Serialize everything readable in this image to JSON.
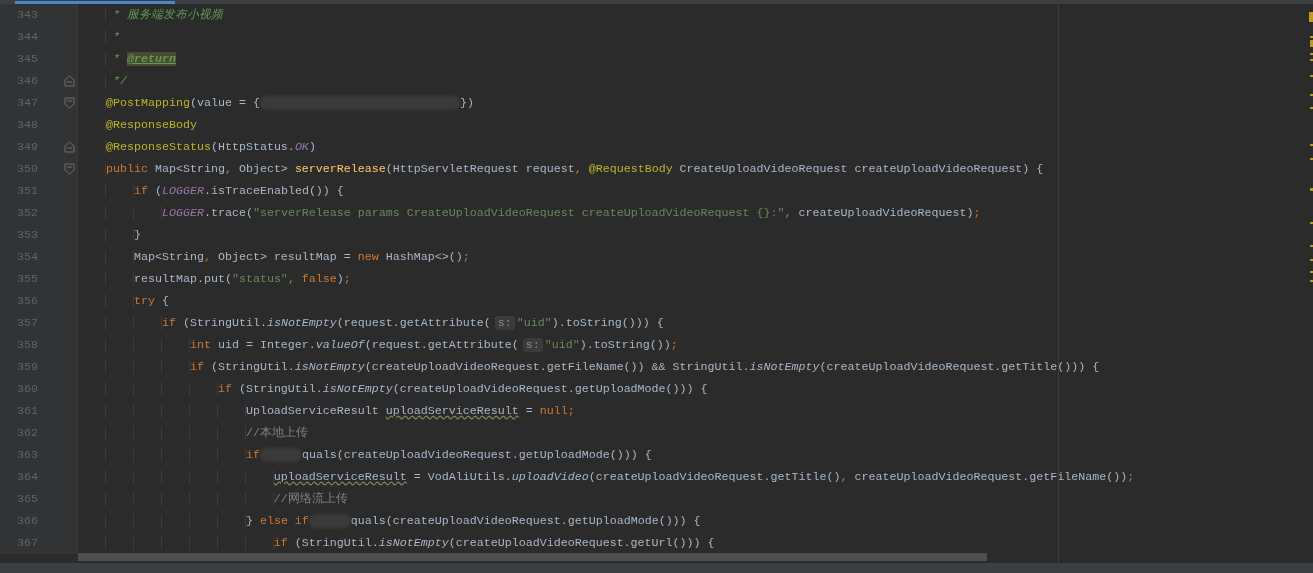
{
  "editor": {
    "lines": [
      {
        "number": "343",
        "fold_start": false,
        "fold_end": false,
        "tokens": [
          {
            "kind": "doc",
            "text": "     * 服务端发布小视频"
          }
        ]
      },
      {
        "number": "344",
        "fold_start": false,
        "fold_end": false,
        "tokens": [
          {
            "kind": "doc",
            "text": "     *"
          }
        ]
      },
      {
        "number": "345",
        "fold_start": false,
        "fold_end": false,
        "tokens": [
          {
            "kind": "doc",
            "text": "     * "
          },
          {
            "kind": "doctag",
            "text": "@return"
          }
        ]
      },
      {
        "number": "346",
        "fold_start": false,
        "fold_end": true,
        "tokens": [
          {
            "kind": "doc",
            "text": "     */"
          }
        ]
      },
      {
        "number": "347",
        "fold_start": true,
        "fold_end": false,
        "tokens": [
          {
            "kind": "annotation",
            "text": "    @PostMapping"
          },
          {
            "kind": "plain",
            "text": "(value = {"
          },
          {
            "kind": "redacted",
            "long": true
          },
          {
            "kind": "plain",
            "text": "})"
          }
        ]
      },
      {
        "number": "348",
        "fold_start": false,
        "fold_end": false,
        "tokens": [
          {
            "kind": "annotation",
            "text": "    @ResponseBody"
          }
        ]
      },
      {
        "number": "349",
        "fold_start": false,
        "fold_end": true,
        "tokens": [
          {
            "kind": "annotation",
            "text": "    @ResponseStatus"
          },
          {
            "kind": "plain",
            "text": "(HttpStatus."
          },
          {
            "kind": "field",
            "text": "OK"
          },
          {
            "kind": "plain",
            "text": ")"
          }
        ]
      },
      {
        "number": "350",
        "fold_start": true,
        "fold_end": false,
        "tokens": [
          {
            "kind": "keyword",
            "text": "    public "
          },
          {
            "kind": "plain",
            "text": "Map<String"
          },
          {
            "kind": "punct",
            "text": ","
          },
          {
            "kind": "plain",
            "text": " Object> "
          },
          {
            "kind": "declaration",
            "text": "serverRelease"
          },
          {
            "kind": "plain",
            "text": "(HttpServletRequest request"
          },
          {
            "kind": "punct",
            "text": ","
          },
          {
            "kind": "annotation",
            "text": " @RequestBody"
          },
          {
            "kind": "plain",
            "text": " CreateUploadVideoRequest createUploadVideoRequest) {"
          }
        ]
      },
      {
        "number": "351",
        "fold_start": false,
        "fold_end": false,
        "tokens": [
          {
            "kind": "keyword",
            "text": "        if"
          },
          {
            "kind": "plain",
            "text": " ("
          },
          {
            "kind": "field",
            "text": "LOGGER"
          },
          {
            "kind": "plain",
            "text": ".isTraceEnabled()) {"
          }
        ]
      },
      {
        "number": "352",
        "fold_start": false,
        "fold_end": false,
        "tokens": [
          {
            "kind": "field",
            "text": "            LOGGER"
          },
          {
            "kind": "plain",
            "text": ".trace("
          },
          {
            "kind": "string",
            "text": "\"serverRelease params CreateUploadVideoRequest createUploadVideoRequest {}:\""
          },
          {
            "kind": "punct",
            "text": ","
          },
          {
            "kind": "plain",
            "text": " createUploadVideoRequest)"
          },
          {
            "kind": "punct",
            "text": ";"
          }
        ]
      },
      {
        "number": "353",
        "fold_start": false,
        "fold_end": false,
        "tokens": [
          {
            "kind": "plain",
            "text": "        }"
          }
        ]
      },
      {
        "number": "354",
        "fold_start": false,
        "fold_end": false,
        "tokens": [
          {
            "kind": "plain",
            "text": "        Map<String"
          },
          {
            "kind": "punct",
            "text": ","
          },
          {
            "kind": "plain",
            "text": " Object> resultMap = "
          },
          {
            "kind": "keyword",
            "text": "new"
          },
          {
            "kind": "plain",
            "text": " HashMap<>()"
          },
          {
            "kind": "punct",
            "text": ";"
          }
        ]
      },
      {
        "number": "355",
        "fold_start": false,
        "fold_end": false,
        "tokens": [
          {
            "kind": "plain",
            "text": "        resultMap.put("
          },
          {
            "kind": "string",
            "text": "\"status\""
          },
          {
            "kind": "punct",
            "text": ","
          },
          {
            "kind": "keyword",
            "text": " false"
          },
          {
            "kind": "plain",
            "text": ")"
          },
          {
            "kind": "punct",
            "text": ";"
          }
        ]
      },
      {
        "number": "356",
        "fold_start": false,
        "fold_end": false,
        "tokens": [
          {
            "kind": "keyword",
            "text": "        try"
          },
          {
            "kind": "plain",
            "text": " {"
          }
        ]
      },
      {
        "number": "357",
        "fold_start": false,
        "fold_end": false,
        "tokens": [
          {
            "kind": "keyword",
            "text": "            if"
          },
          {
            "kind": "plain",
            "text": " (StringUtil."
          },
          {
            "kind": "static",
            "text": "isNotEmpty"
          },
          {
            "kind": "plain",
            "text": "(request.getAttribute("
          },
          {
            "kind": "hint",
            "text": "s:"
          },
          {
            "kind": "string",
            "text": "\"uid\""
          },
          {
            "kind": "plain",
            "text": ").toString())) {"
          }
        ]
      },
      {
        "number": "358",
        "fold_start": false,
        "fold_end": false,
        "tokens": [
          {
            "kind": "keyword",
            "text": "                int"
          },
          {
            "kind": "plain",
            "text": " uid = Integer."
          },
          {
            "kind": "static",
            "text": "valueOf"
          },
          {
            "kind": "plain",
            "text": "(request.getAttribute("
          },
          {
            "kind": "hint",
            "text": "s:"
          },
          {
            "kind": "string",
            "text": "\"uid\""
          },
          {
            "kind": "plain",
            "text": ").toString())"
          },
          {
            "kind": "punct",
            "text": ";"
          }
        ]
      },
      {
        "number": "359",
        "fold_start": false,
        "fold_end": false,
        "tokens": [
          {
            "kind": "keyword",
            "text": "                if"
          },
          {
            "kind": "plain",
            "text": " (StringUtil."
          },
          {
            "kind": "static",
            "text": "isNotEmpty"
          },
          {
            "kind": "plain",
            "text": "(createUploadVideoRequest.getFileName()) && StringUtil."
          },
          {
            "kind": "static",
            "text": "isNotEmpty"
          },
          {
            "kind": "plain",
            "text": "(createUploadVideoRequest.getTitle())) {"
          }
        ]
      },
      {
        "number": "360",
        "fold_start": false,
        "fold_end": false,
        "tokens": [
          {
            "kind": "keyword",
            "text": "                    if"
          },
          {
            "kind": "plain",
            "text": " (StringUtil."
          },
          {
            "kind": "static",
            "text": "isNotEmpty"
          },
          {
            "kind": "plain",
            "text": "(createUploadVideoRequest.getUploadMode())) {"
          }
        ]
      },
      {
        "number": "361",
        "fold_start": false,
        "fold_end": false,
        "tokens": [
          {
            "kind": "plain",
            "text": "                        UploadServiceResult "
          },
          {
            "kind": "warning",
            "text": "uploadServiceResult"
          },
          {
            "kind": "plain",
            "text": " = "
          },
          {
            "kind": "keyword",
            "text": "null"
          },
          {
            "kind": "punct",
            "text": ";"
          }
        ]
      },
      {
        "number": "362",
        "fold_start": false,
        "fold_end": false,
        "tokens": [
          {
            "kind": "comment",
            "text": "                        //本地上传"
          }
        ]
      },
      {
        "number": "363",
        "fold_start": false,
        "fold_end": false,
        "tokens": [
          {
            "kind": "keyword",
            "text": "                        if"
          },
          {
            "kind": "redacted",
            "long": false
          },
          {
            "kind": "plain",
            "text": "quals(createUploadVideoRequest.getUploadMode())) {"
          }
        ]
      },
      {
        "number": "364",
        "fold_start": false,
        "fold_end": false,
        "tokens": [
          {
            "kind": "warning",
            "text": "                            uploadServiceResult"
          },
          {
            "kind": "plain",
            "text": " = VodAliUtils."
          },
          {
            "kind": "static",
            "text": "uploadVideo"
          },
          {
            "kind": "plain",
            "text": "(createUploadVideoRequest.getTitle()"
          },
          {
            "kind": "punct",
            "text": ","
          },
          {
            "kind": "plain",
            "text": " createUploadVideoRequest.getFileName())"
          },
          {
            "kind": "punct",
            "text": ";"
          }
        ]
      },
      {
        "number": "365",
        "fold_start": false,
        "fold_end": false,
        "tokens": [
          {
            "kind": "comment",
            "text": "                            //网络流上传"
          }
        ]
      },
      {
        "number": "366",
        "fold_start": false,
        "fold_end": false,
        "tokens": [
          {
            "kind": "plain",
            "text": "                        } "
          },
          {
            "kind": "keyword",
            "text": "else if"
          },
          {
            "kind": "redacted",
            "long": false
          },
          {
            "kind": "plain",
            "text": "quals(createUploadVideoRequest.getUploadMode())) {"
          }
        ]
      },
      {
        "number": "367",
        "fold_start": false,
        "fold_end": false,
        "tokens": [
          {
            "kind": "keyword",
            "text": "                            if"
          },
          {
            "kind": "plain",
            "text": " (StringUtil."
          },
          {
            "kind": "static",
            "text": "isNotEmpty"
          },
          {
            "kind": "plain",
            "text": "(createUploadVideoRequest.getUrl())) {"
          }
        ]
      }
    ]
  }
}
